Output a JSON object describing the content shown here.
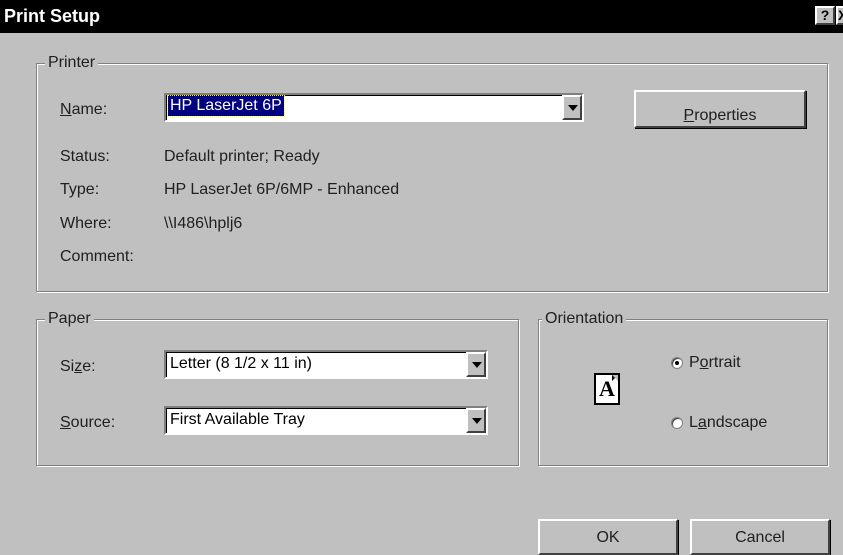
{
  "window": {
    "title": "Print Setup",
    "help_glyph": "?",
    "close_glyph": "X"
  },
  "printer": {
    "legend": "Printer",
    "name_label_pre": "",
    "name_label_accel": "N",
    "name_label_post": "ame:",
    "name_value": "HP LaserJet 6P",
    "properties_accel": "P",
    "properties_rest": "roperties",
    "status_label": "Status:",
    "status_value": "Default printer; Ready",
    "type_label": "Type:",
    "type_value": "HP LaserJet 6P/6MP - Enhanced",
    "where_label": "Where:",
    "where_value": "\\\\I486\\hplj6",
    "comment_label": "Comment:",
    "comment_value": ""
  },
  "paper": {
    "legend": "Paper",
    "size_label_pre": "Si",
    "size_label_accel": "z",
    "size_label_post": "e:",
    "size_value": "Letter (8 1/2 x 11 in)",
    "source_label_pre": "",
    "source_label_accel": "S",
    "source_label_post": "ource:",
    "source_value": "First Available Tray"
  },
  "orientation": {
    "legend": "Orientation",
    "icon_letter": "A",
    "portrait_pre": "P",
    "portrait_accel": "o",
    "portrait_post": "rtrait",
    "landscape_pre": "L",
    "landscape_accel": "a",
    "landscape_post": "ndscape",
    "selected": "portrait"
  },
  "buttons": {
    "ok": "OK",
    "cancel": "Cancel"
  },
  "icons": {
    "dropdown": "chevron-down-icon",
    "page": "portrait-page-icon"
  }
}
